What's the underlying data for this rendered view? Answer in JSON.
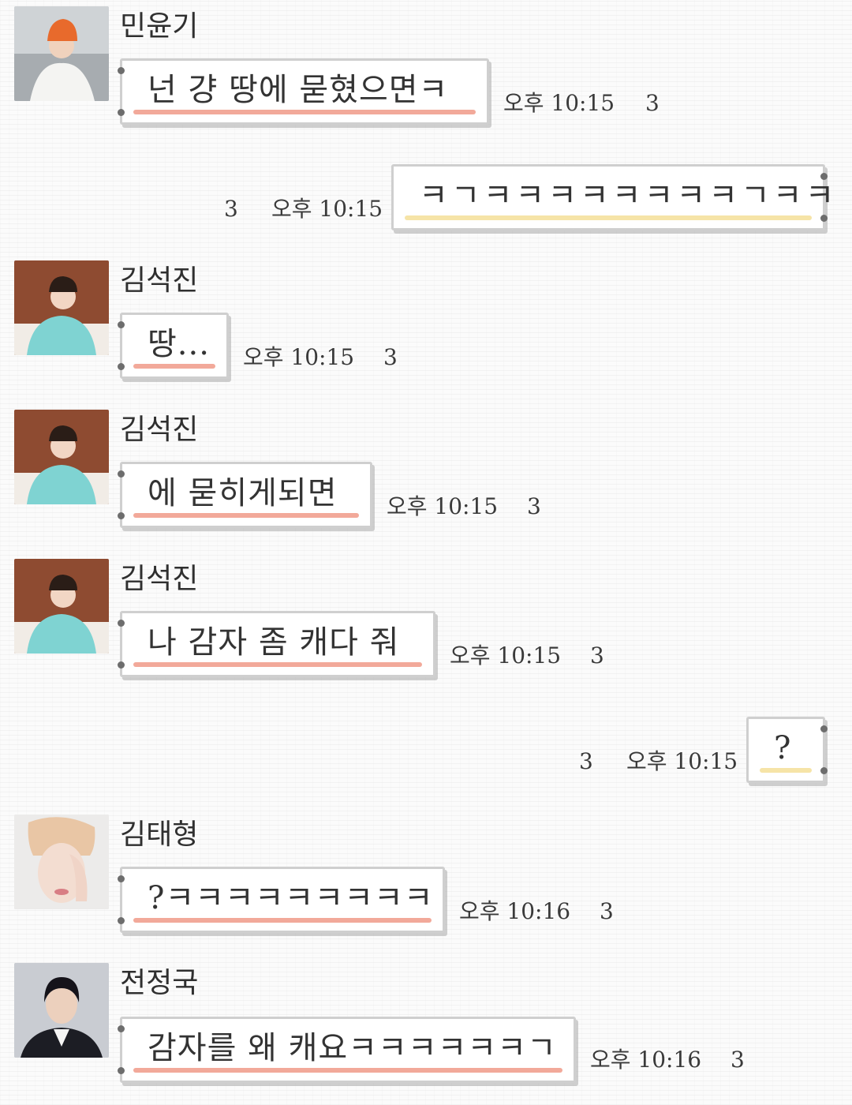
{
  "messages": [
    {
      "sender": "민윤기",
      "text": "넌 걍 땅에 묻혔으면ㅋ",
      "time": "오후 10:15",
      "unread": "3"
    },
    {
      "sender": "",
      "text": "ㅋㄱㅋㅋㅋㅋㅋㅋㅋㅋㄱㅋㅋ",
      "time": "오후 10:15",
      "unread": "3"
    },
    {
      "sender": "김석진",
      "text": "땅...",
      "time": "오후 10:15",
      "unread": "3"
    },
    {
      "sender": "김석진",
      "text": "에 묻히게되면",
      "time": "오후 10:15",
      "unread": "3"
    },
    {
      "sender": "김석진",
      "text": "나 감자 좀 캐다 줘",
      "time": "오후 10:15",
      "unread": "3"
    },
    {
      "sender": "",
      "text": "?",
      "time": "오후 10:15",
      "unread": "3"
    },
    {
      "sender": "김태형",
      "text": "?ㅋㅋㅋㅋㅋㅋㅋㅋㅋ",
      "time": "오후 10:16",
      "unread": "3"
    },
    {
      "sender": "전정국",
      "text": "감자를 왜 캐요ㅋㅋㅋㅋㅋㅋㄱ",
      "time": "오후 10:16",
      "unread": "3"
    }
  ],
  "colors": {
    "received_underline": "#f2a99a",
    "sent_underline": "#f6e4a7",
    "bubble_border": "#cfcfcf",
    "background": "#fbfbfb"
  }
}
